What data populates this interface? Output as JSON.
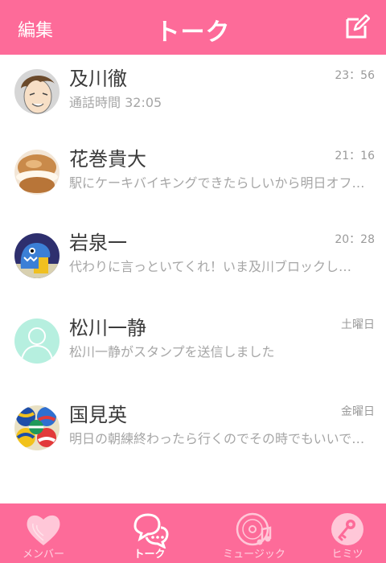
{
  "header": {
    "edit_label": "編集",
    "title": "トーク",
    "compose_icon": "compose-icon"
  },
  "chats": [
    {
      "name": "及川徹",
      "message": "通話時間 32:05",
      "time": "23：56",
      "avatar": "avatar-oikawa"
    },
    {
      "name": "花巻貴大",
      "message": "駅にケーキバイキングできたらしいから明日オフ…",
      "time": "21：16",
      "avatar": "avatar-cream-puff"
    },
    {
      "name": "岩泉一",
      "message": "代わりに言っといてくれ！いま及川ブロックし…",
      "time": "20：28",
      "avatar": "avatar-monster"
    },
    {
      "name": "松川一静",
      "message": "松川一静がスタンプを送信しました",
      "time": "土曜日",
      "avatar": "avatar-default"
    },
    {
      "name": "国見英",
      "message": "明日の朝練終わったら行くのでその時でもいいで…",
      "time": "金曜日",
      "avatar": "avatar-volleyballs"
    }
  ],
  "tabs": [
    {
      "label": "メンバー",
      "icon": "heart-icon",
      "active": false
    },
    {
      "label": "トーク",
      "icon": "chat-bubbles-icon",
      "active": true
    },
    {
      "label": "ミュージック",
      "icon": "music-disc-icon",
      "active": false
    },
    {
      "label": "ヒミツ",
      "icon": "key-icon",
      "active": false
    }
  ],
  "colors": {
    "accent": "#fd6b99",
    "name_text": "#3b3b3b",
    "secondary_text": "#a6a6a6"
  }
}
